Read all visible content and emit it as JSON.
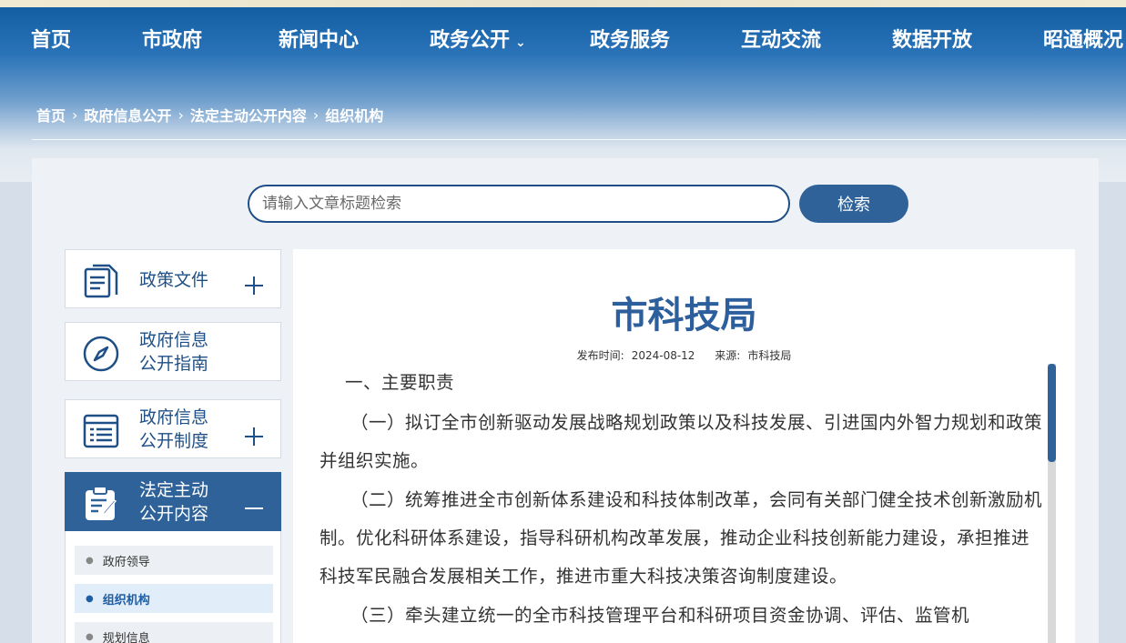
{
  "nav": {
    "items": [
      "首页",
      "市政府",
      "新闻中心",
      "政务公开",
      "政务服务",
      "互动交流",
      "数据开放",
      "昭通概况"
    ]
  },
  "breadcrumb": [
    "首页",
    "政府信息公开",
    "法定主动公开内容",
    "组织机构"
  ],
  "search": {
    "placeholder": "请输入文章标题检索",
    "button": "检索"
  },
  "sidebar": {
    "cards": [
      {
        "label_line1": "政策文件",
        "label_line2": "",
        "icon": "document-icon",
        "toggle": "plus"
      },
      {
        "label_line1": "政府信息",
        "label_line2": "公开指南",
        "icon": "compass-icon",
        "toggle": "none"
      },
      {
        "label_line1": "政府信息",
        "label_line2": "公开制度",
        "icon": "list-icon",
        "toggle": "plus"
      },
      {
        "label_line1": "法定主动",
        "label_line2": "公开内容",
        "icon": "clipboard-icon",
        "toggle": "minus"
      }
    ],
    "sub_items": [
      "政府领导",
      "组织机构",
      "规划信息"
    ]
  },
  "article": {
    "title": "市科技局",
    "publish_label": "发布时间:",
    "publish_date": "2024-08-12",
    "source_label": "来源:",
    "source": "市科技局",
    "paragraphs": [
      "一、主要职责",
      "（一）拟订全市创新驱动发展战略规划政策以及科技发展、引进国内外智力规划和政策并组织实施。",
      "（二）统筹推进全市创新体系建设和科技体制改革，会同有关部门健全技术创新激励机制。优化科研体系建设，指导科研机构改革发展，推动企业科技创新能力建设，承担推进科技军民融合发展相关工作，推进市重大科技决策咨询制度建设。",
      "（三）牵头建立统一的全市科技管理平台和科研项目资金协调、评估、监管机"
    ]
  },
  "colors": {
    "primary": "#2f6299",
    "title": "#2c5f9c",
    "link": "#1e4f86"
  }
}
